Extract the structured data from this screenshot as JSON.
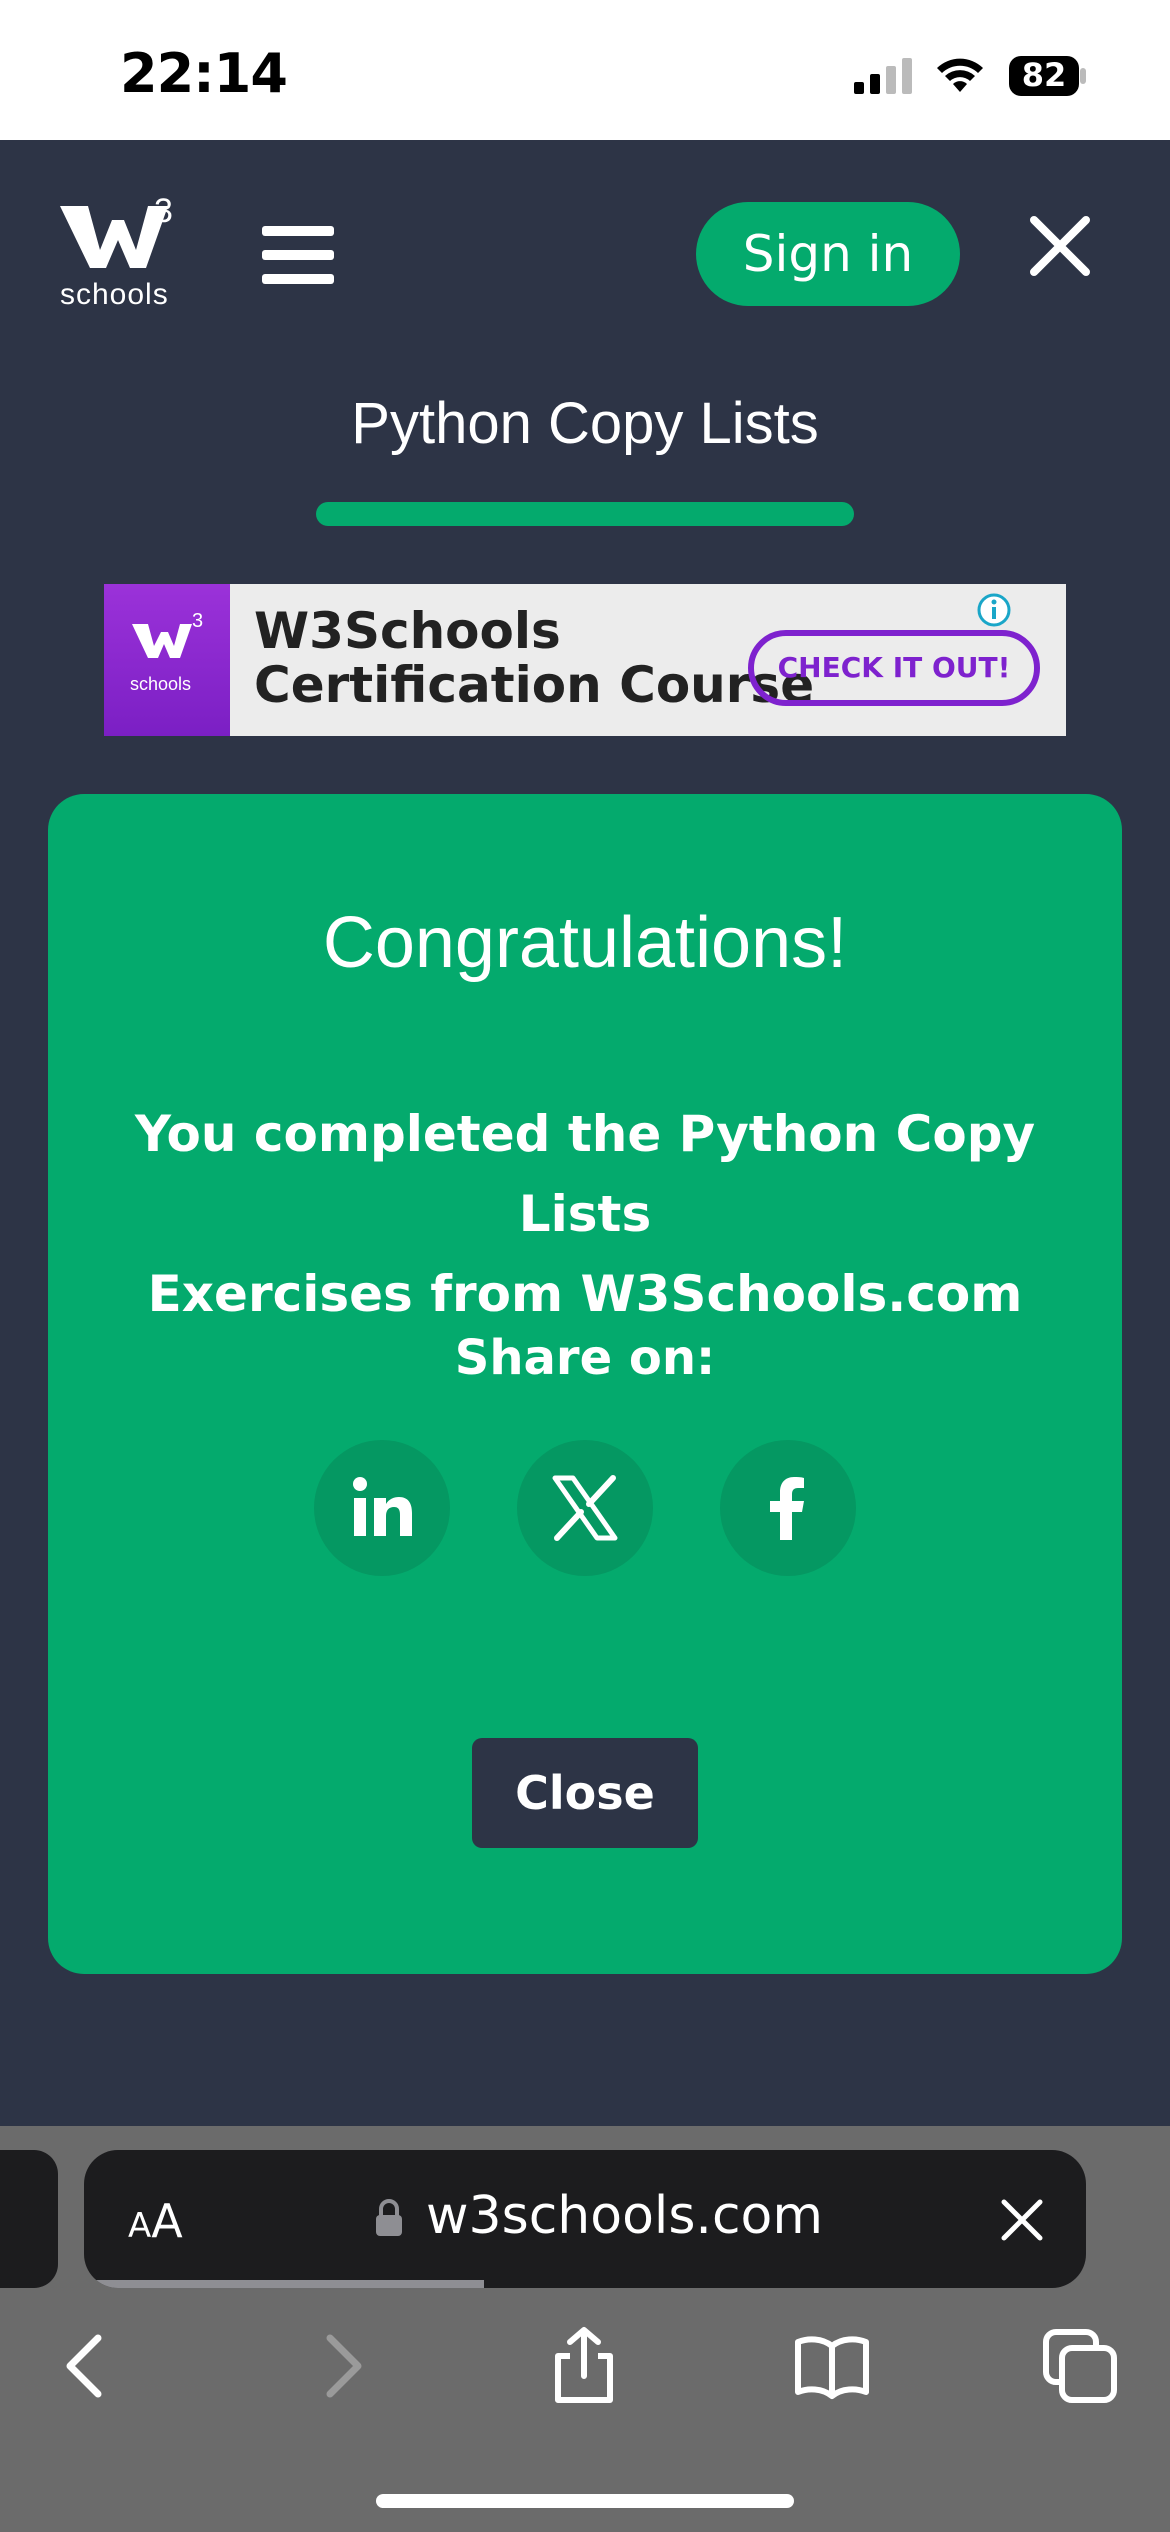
{
  "status_bar": {
    "time": "22:14",
    "battery": "82"
  },
  "header": {
    "logo_superscript": "3",
    "logo_text": "schools",
    "signin_label": "Sign in"
  },
  "page": {
    "title": "Python Copy Lists",
    "progress_fraction": 1.0
  },
  "ad": {
    "logo_superscript": "3",
    "logo_text": "schools",
    "line1": "W3Schools",
    "line2": "Certification Course",
    "cta": "CHECK IT OUT!"
  },
  "card": {
    "title": "Congratulations!",
    "message_line1": "You completed the Python Copy Lists",
    "message_line2": "Exercises from W3Schools.com",
    "share_label": "Share on:",
    "share_icons": [
      "linkedin-icon",
      "x-icon",
      "facebook-icon"
    ],
    "close_label": "Close"
  },
  "browser": {
    "aa_small": "A",
    "aa_big": "A",
    "url": "w3schools.com"
  },
  "colors": {
    "brand_green": "#04aa6d",
    "dark_bg": "#2d3446",
    "ad_purple": "#7e22ce"
  }
}
